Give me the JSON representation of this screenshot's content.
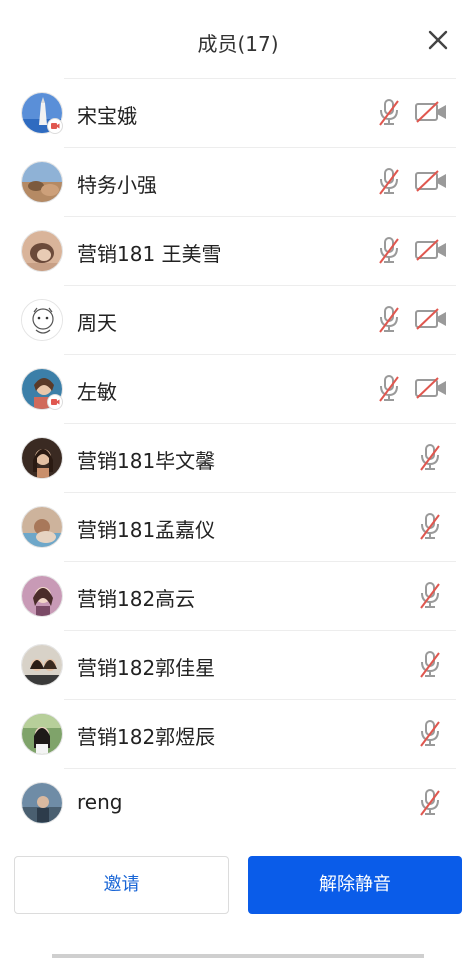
{
  "header": {
    "title": "成员(17)",
    "close_icon": "close-icon"
  },
  "members": [
    {
      "name": "宋宝娥",
      "mic": "muted",
      "camera": "off",
      "has_badge": true
    },
    {
      "name": "特务小强",
      "mic": "muted",
      "camera": "off",
      "has_badge": false
    },
    {
      "name": "营销181 王美雪",
      "mic": "muted",
      "camera": "off",
      "has_badge": false
    },
    {
      "name": "周天",
      "mic": "muted",
      "camera": "off",
      "has_badge": false
    },
    {
      "name": "左敏",
      "mic": "muted",
      "camera": "off",
      "has_badge": true
    },
    {
      "name": "营销181毕文馨",
      "mic": "muted",
      "camera": "none",
      "has_badge": false
    },
    {
      "name": "营销181孟嘉仪",
      "mic": "muted",
      "camera": "none",
      "has_badge": false
    },
    {
      "name": "营销182高云",
      "mic": "muted",
      "camera": "none",
      "has_badge": false
    },
    {
      "name": "营销182郭佳星",
      "mic": "muted",
      "camera": "none",
      "has_badge": false
    },
    {
      "name": "营销182郭煜辰",
      "mic": "muted",
      "camera": "none",
      "has_badge": false
    },
    {
      "name": "reng",
      "mic": "muted",
      "camera": "none",
      "has_badge": false
    }
  ],
  "footer": {
    "invite_label": "邀请",
    "unmute_all_label": "解除静音"
  },
  "colors": {
    "primary_blue": "#0a5ce9",
    "link_blue": "#1a66d6",
    "muted_red": "#e0574f",
    "icon_gray": "#9a9a9a"
  }
}
